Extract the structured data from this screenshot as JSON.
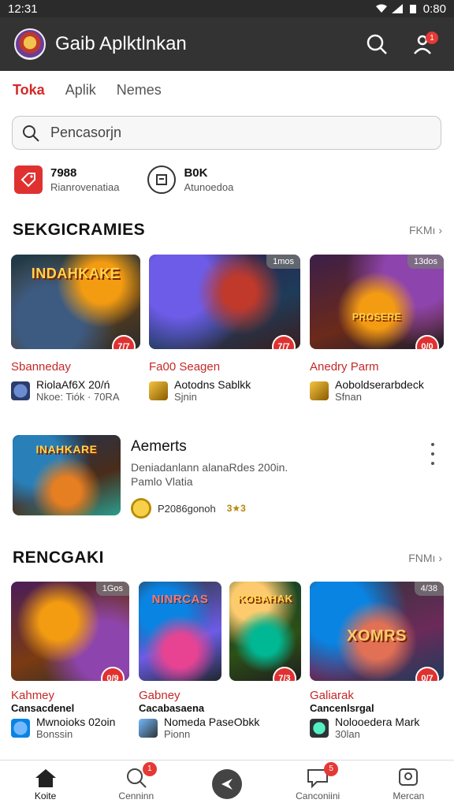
{
  "status_bar": {
    "time": "12:31",
    "battery": "0:80"
  },
  "app_bar": {
    "title": "Gaib Aplktlnkan"
  },
  "notifications": {
    "count": "1"
  },
  "tabs": [
    {
      "label": "Toka"
    },
    {
      "label": "Aplik"
    },
    {
      "label": "Nemes"
    }
  ],
  "search": {
    "placeholder": "Pencasorjn"
  },
  "quick_links": [
    {
      "title": "7988",
      "subtitle": "Rianrovenatiaa"
    },
    {
      "title": "B0K",
      "subtitle": "Atunoedoa"
    }
  ],
  "section1": {
    "title": "SEKGICRAMIES",
    "more": "FKMı ›",
    "cards": [
      {
        "thumb_text": "INDAHKAKE",
        "corner": "",
        "rating": "7/7",
        "title": "Sbanneday",
        "dev": "RiolaAf6X 20/ń",
        "sub": "Nkoe: Tiók · 70RA"
      },
      {
        "thumb_text": "",
        "corner": "1mos",
        "rating": "7/7",
        "title": "Fa00 Seagen",
        "dev": "Aotodns Sablkk",
        "sub": "Sjnin"
      },
      {
        "thumb_text": "PROSERE",
        "corner": "13dos",
        "rating": "0/0",
        "title": "Anedry Parm",
        "dev": "Aoboldserarbdeck",
        "sub": "Sfnan"
      }
    ]
  },
  "feature": {
    "thumb_text": "INAHKARE",
    "title": "Aemerts",
    "desc_1": "Deniadanlann alanaRdes 200in.",
    "desc_2": "Pamlo Vlatia",
    "meta": "P2086gonoh",
    "badge": "3★3"
  },
  "section2": {
    "title": "RENCGAKI",
    "more": "FNMı ›",
    "cards": [
      {
        "thumb_text": "",
        "corner": "1Gos",
        "rating": "0/9",
        "title": "Kahmey",
        "caption": "Cansacdenel",
        "dev": "Mwnoioks 02oin",
        "sub": "Bonssin"
      },
      {
        "thumb_text": "NINRCAS",
        "corner": "",
        "rating": "",
        "title": "Gabney",
        "caption": "Cacabasaena",
        "dev": "Nomeda PaseObkk",
        "sub": "Pionn"
      },
      {
        "thumb_text": "KOBAHAK",
        "corner": "",
        "rating": "7/3",
        "title": "",
        "caption": "",
        "dev": "",
        "sub": ""
      },
      {
        "thumb_text": "XOMRS",
        "corner": "4/38",
        "rating": "0/7",
        "title": "Galiarak",
        "caption": "Cancenlsrgal",
        "dev": "Nolooedera Mark",
        "sub": "30lan"
      }
    ]
  },
  "bottom_nav": [
    {
      "label": "Koite"
    },
    {
      "label": "Cenninn",
      "badge": "1"
    },
    {
      "label": ""
    },
    {
      "label": "Canconiini",
      "badge": "5"
    },
    {
      "label": "Mercan"
    }
  ]
}
